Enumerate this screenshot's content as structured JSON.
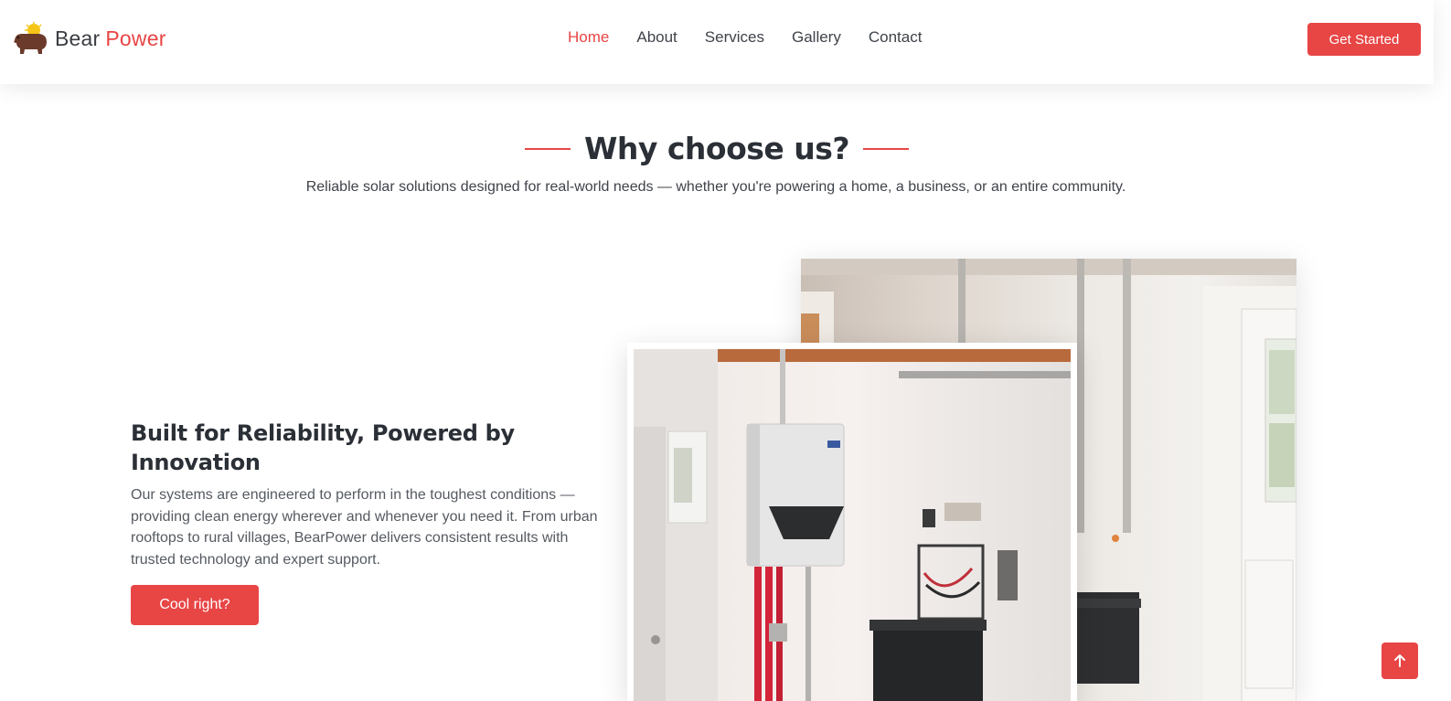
{
  "brand": {
    "name_part1": "Bear",
    "name_part2": "Power",
    "logo_icon": "bear-sun-logo"
  },
  "nav": {
    "items": [
      {
        "label": "Home",
        "active": true
      },
      {
        "label": "About",
        "active": false
      },
      {
        "label": "Services",
        "active": false
      },
      {
        "label": "Gallery",
        "active": false
      },
      {
        "label": "Contact",
        "active": false
      }
    ]
  },
  "header": {
    "cta_label": "Get Started"
  },
  "section": {
    "title": "Why choose us?",
    "subtitle": "Reliable solar solutions designed for real-world needs — whether you're powering a home, a business, or an entire community."
  },
  "feature": {
    "title": "Built for Reliability, Powered by Innovation",
    "text": "Our systems are engineered to perform in the toughest conditions — providing clean energy wherever and whenever you need it. From urban rooftops to rural villages, BearPower delivers consistent results with trusted technology and expert support.",
    "button_label": "Cool right?"
  },
  "images": {
    "back_icon": "utility-room-photo",
    "front_icon": "solar-inverter-battery-photo"
  },
  "scroll_top": {
    "icon": "arrow-up-icon"
  },
  "colors": {
    "accent": "#e84545",
    "text_dark": "#2b2f36",
    "text_body": "#555a61"
  }
}
